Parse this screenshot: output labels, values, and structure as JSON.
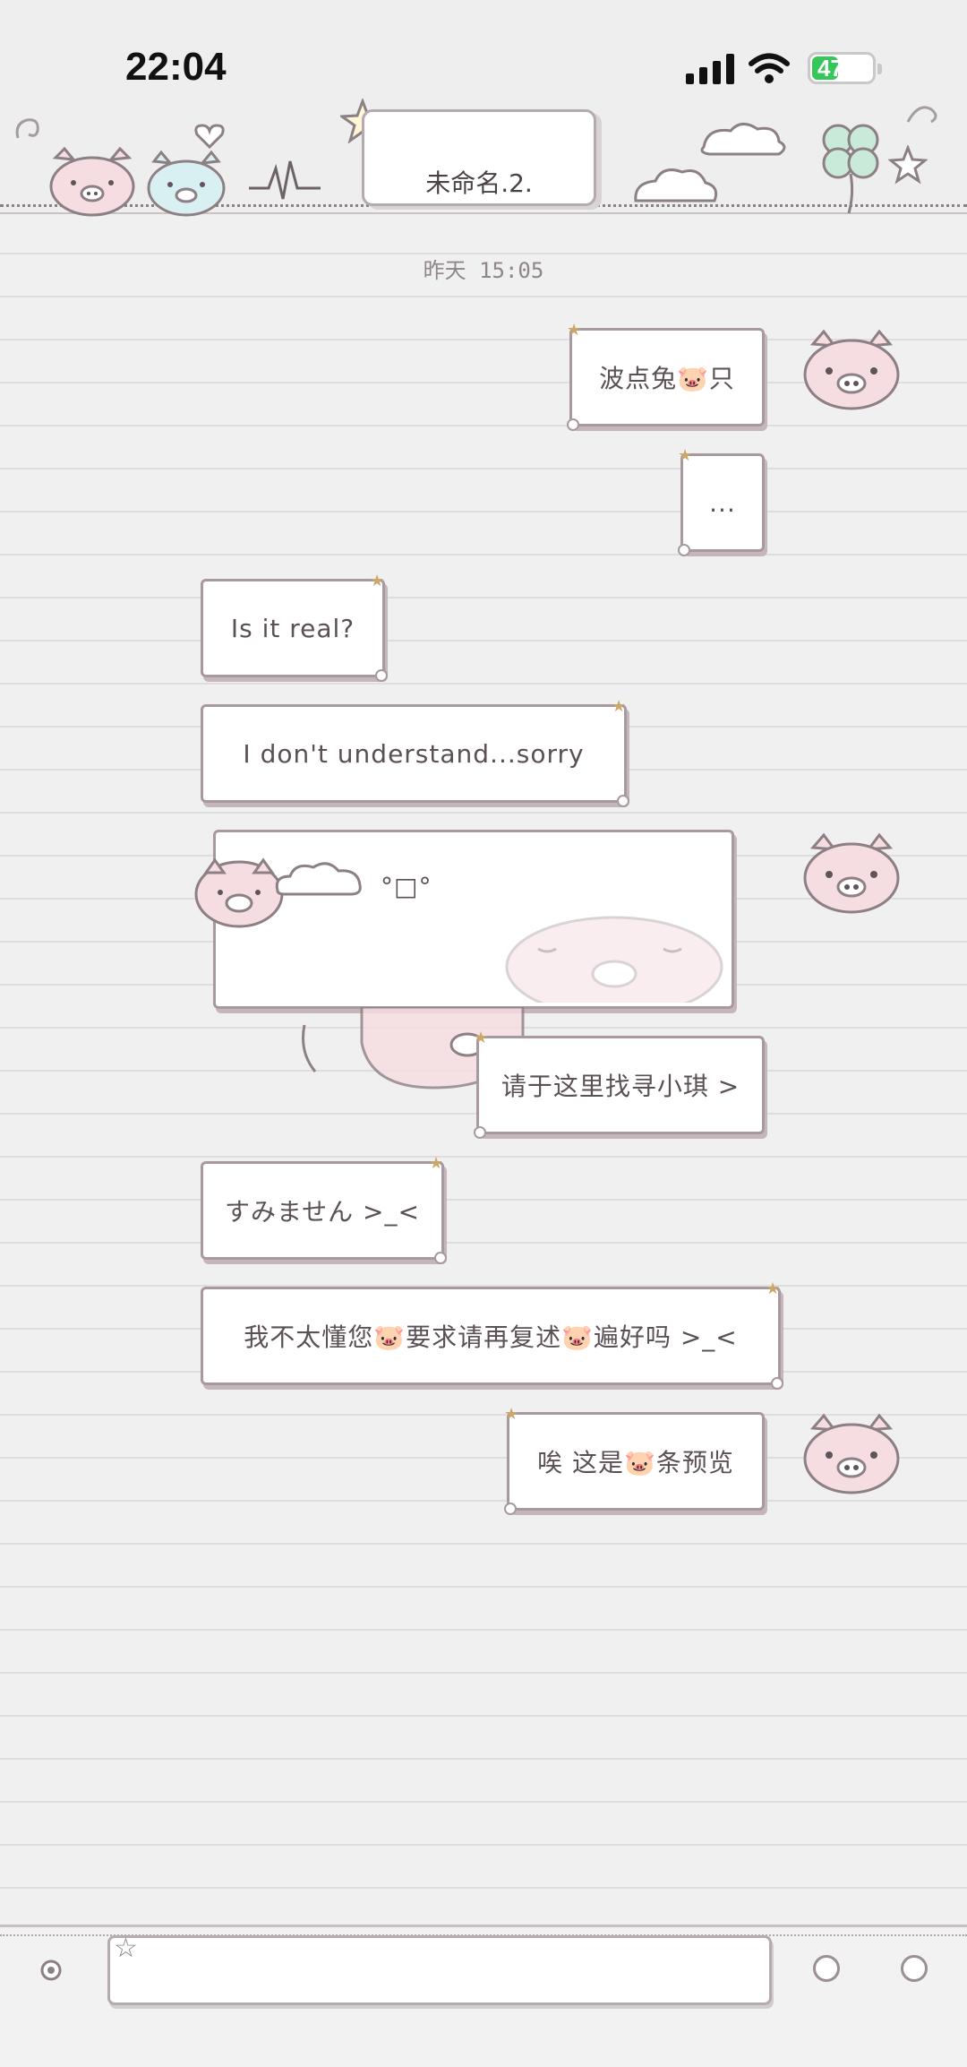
{
  "status_bar": {
    "time": "22:04",
    "battery_level": "47",
    "battery_fraction": 0.47
  },
  "header": {
    "title": "未命名.2."
  },
  "chat": {
    "timestamp": "昨天 15:05",
    "messages": [
      {
        "side": "right",
        "text": "波点兔🐷只",
        "avatar": "pig-avatar"
      },
      {
        "side": "right",
        "text": "..."
      },
      {
        "side": "left",
        "text": "Is it real?"
      },
      {
        "side": "left",
        "text": "I don't understand...sorry"
      },
      {
        "side": "right",
        "text": "°□°",
        "type": "sticker-card",
        "avatar": "pig-avatar"
      },
      {
        "side": "right",
        "text": "请于这里找寻小琪 >"
      },
      {
        "side": "left",
        "text": "すみません >_<"
      },
      {
        "side": "left",
        "text": "我不太懂您🐷要求请再复述🐷遍好吗 >_<"
      },
      {
        "side": "right",
        "text": "唉 这是🐷条预览",
        "avatar": "pig-avatar"
      }
    ]
  },
  "input": {
    "placeholder": ""
  },
  "colors": {
    "background": "#f1f0f0",
    "bubble_border": "#a8989f",
    "pig_pink": "#f6dde2",
    "pig_blue": "#d9f0f3",
    "clover_green": "#c9ead8",
    "battery_green": "#36c759"
  },
  "icons": {
    "signal": "signal-icon",
    "wifi": "wifi-icon",
    "battery": "battery-icon",
    "voice": "voice-icon",
    "emoji": "emoji-icon",
    "add": "add-icon"
  }
}
